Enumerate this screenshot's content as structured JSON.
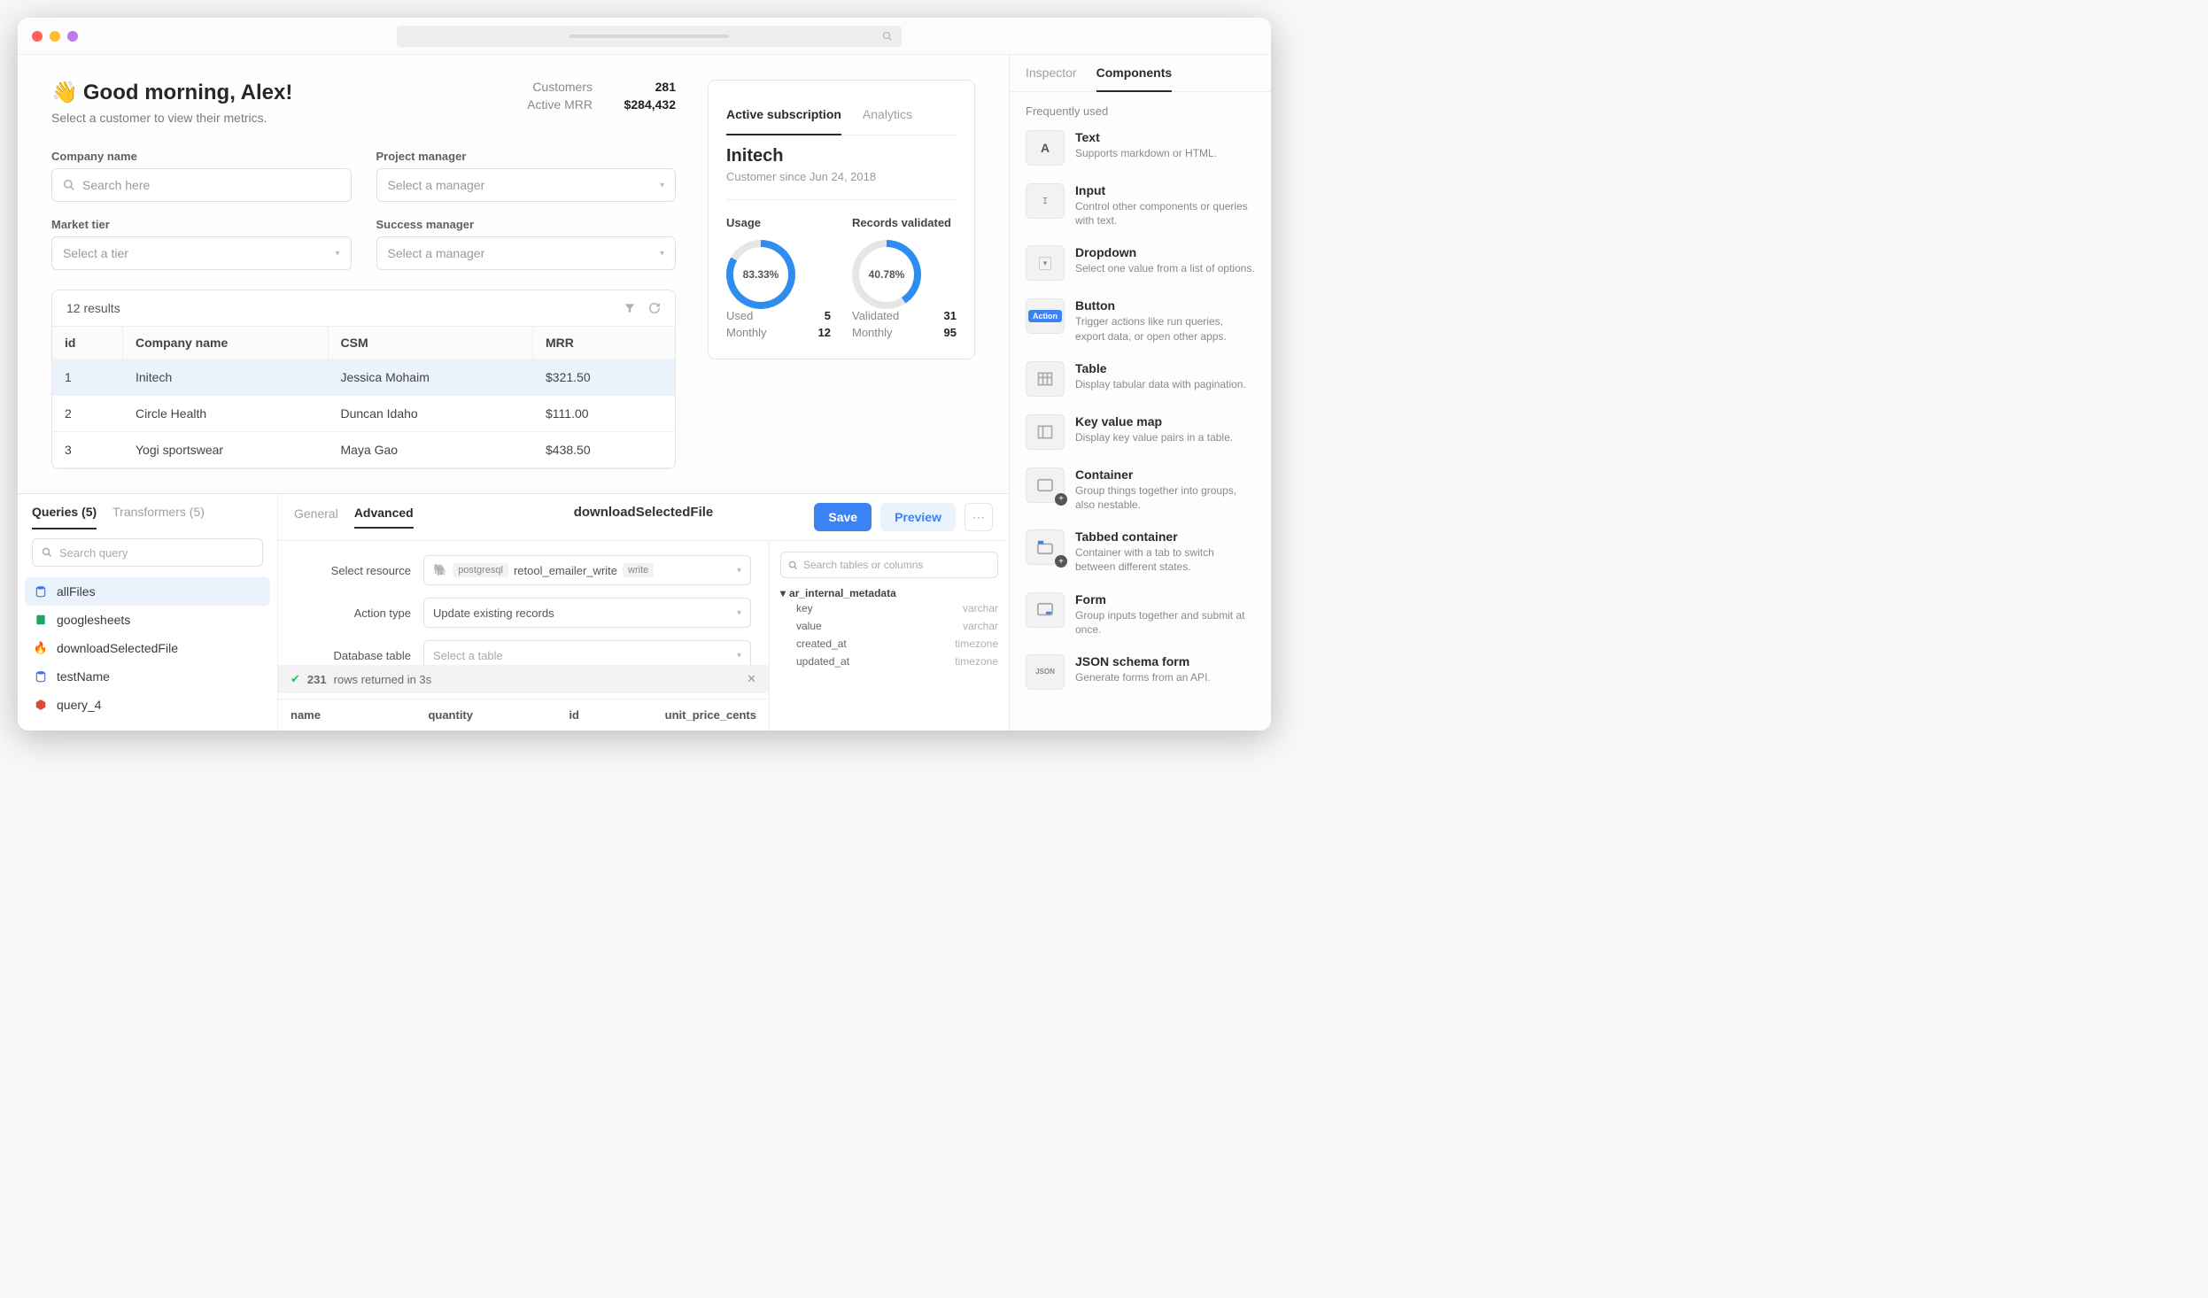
{
  "greeting": {
    "title": "Good morning, Alex!",
    "subtitle": "Select a customer to view their metrics."
  },
  "stats": {
    "rows": [
      {
        "label": "Customers",
        "value": "281"
      },
      {
        "label": "Active MRR",
        "value": "$284,432"
      }
    ]
  },
  "filters": {
    "company": {
      "label": "Company name",
      "placeholder": "Search here"
    },
    "pm": {
      "label": "Project manager",
      "placeholder": "Select a manager"
    },
    "tier": {
      "label": "Market tier",
      "placeholder": "Select a tier"
    },
    "sm": {
      "label": "Success manager",
      "placeholder": "Select a manager"
    }
  },
  "table": {
    "results_label": "12 results",
    "columns": [
      "id",
      "Company name",
      "CSM",
      "MRR"
    ],
    "rows": [
      {
        "id": "1",
        "company": "Initech",
        "csm": "Jessica Mohaim",
        "mrr": "$321.50",
        "selected": true
      },
      {
        "id": "2",
        "company": "Circle Health",
        "csm": "Duncan Idaho",
        "mrr": "$111.00"
      },
      {
        "id": "3",
        "company": "Yogi sportswear",
        "csm": "Maya Gao",
        "mrr": "$438.50"
      }
    ]
  },
  "subscription": {
    "tabs": [
      "Active subscription",
      "Analytics"
    ],
    "active_tab": 0,
    "company": "Initech",
    "since": "Customer since Jun 24, 2018",
    "usage": {
      "header": "Usage",
      "pct": "83.33%",
      "pct_num": 83.33,
      "rows": [
        {
          "k": "Used",
          "v": "5"
        },
        {
          "k": "Monthly",
          "v": "12"
        }
      ]
    },
    "records": {
      "header": "Records validated",
      "pct": "40.78%",
      "pct_num": 40.78,
      "rows": [
        {
          "k": "Validated",
          "v": "31"
        },
        {
          "k": "Monthly",
          "v": "95"
        }
      ]
    }
  },
  "queries_panel": {
    "tabs": {
      "queries": "Queries (5)",
      "transformers": "Transformers (5)"
    },
    "search_placeholder": "Search query",
    "items": [
      {
        "name": "allFiles",
        "icon": "db",
        "active": true
      },
      {
        "name": "googlesheets",
        "icon": "sheets"
      },
      {
        "name": "downloadSelectedFile",
        "icon": "fire"
      },
      {
        "name": "testName",
        "icon": "db"
      },
      {
        "name": "query_4",
        "icon": "cube"
      }
    ]
  },
  "editor": {
    "tabs": {
      "general": "General",
      "advanced": "Advanced"
    },
    "title": "downloadSelectedFile",
    "buttons": {
      "save": "Save",
      "preview": "Preview"
    },
    "fields": {
      "resource": {
        "label": "Select resource",
        "engine": "postgresql",
        "name": "retool_emailer_write",
        "mode": "write"
      },
      "action": {
        "label": "Action type",
        "value": "Update existing records"
      },
      "dbtable": {
        "label": "Database table",
        "placeholder": "Select a table"
      }
    },
    "status": {
      "count": "231",
      "text": "rows returned in 3s"
    },
    "result_columns": [
      "name",
      "quantity",
      "id",
      "unit_price_cents"
    ]
  },
  "schema": {
    "search_placeholder": "Search tables or columns",
    "table": "ar_internal_metadata",
    "cols": [
      {
        "name": "key",
        "type": "varchar"
      },
      {
        "name": "value",
        "type": "varchar"
      },
      {
        "name": "created_at",
        "type": "timezone"
      },
      {
        "name": "updated_at",
        "type": "timezone"
      }
    ]
  },
  "sidebar": {
    "tabs": {
      "inspector": "Inspector",
      "components": "Components"
    },
    "section": "Frequently used",
    "components": [
      {
        "name": "Text",
        "desc": "Supports markdown or HTML.",
        "icon": "text"
      },
      {
        "name": "Input",
        "desc": "Control other components or queries with text.",
        "icon": "input"
      },
      {
        "name": "Dropdown",
        "desc": "Select one value from a list of options.",
        "icon": "dropdown"
      },
      {
        "name": "Button",
        "desc": "Trigger actions like run queries, export data, or open other apps.",
        "icon": "button"
      },
      {
        "name": "Table",
        "desc": "Display tabular data with pagination.",
        "icon": "table"
      },
      {
        "name": "Key value map",
        "desc": "Display key value pairs in a table.",
        "icon": "kvmap"
      },
      {
        "name": "Container",
        "desc": "Group things together into groups, also nestable.",
        "icon": "container"
      },
      {
        "name": "Tabbed container",
        "desc": "Container with a tab to switch between different states.",
        "icon": "tabbed"
      },
      {
        "name": "Form",
        "desc": "Group inputs together and submit at once.",
        "icon": "form"
      },
      {
        "name": "JSON schema form",
        "desc": "Generate forms from an API.",
        "icon": "json"
      }
    ]
  }
}
